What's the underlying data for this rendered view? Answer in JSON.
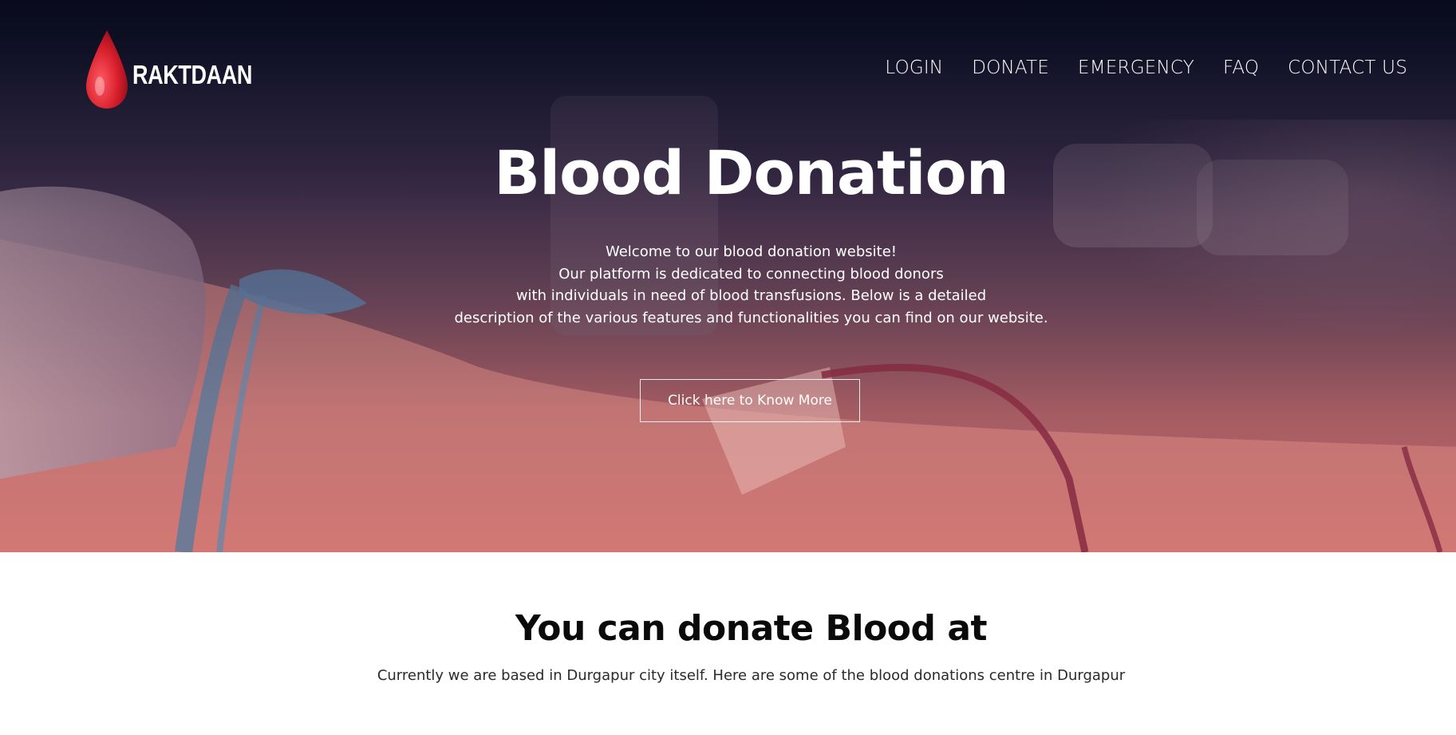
{
  "brand": {
    "name": "RAKTDAAN",
    "logo_icon": "blood-drop-icon",
    "color": "#d61f2c"
  },
  "nav": {
    "items": [
      "LOGIN",
      "DONATE",
      "EMERGENCY",
      "FAQ",
      "CONTACT US"
    ]
  },
  "hero": {
    "title": "Blood Donation",
    "description": [
      "Welcome to our blood donation website!",
      "Our platform is dedicated to connecting blood donors",
      "with individuals in need of blood transfusions. Below is a detailed",
      "description of the various features and functionalities you can find on our website."
    ],
    "button_label": "Click here to Know More"
  },
  "donate_section": {
    "title": "You can donate Blood at",
    "subtitle": "Currently we are based in Durgapur city itself. Here are some of the blood donations centre in Durgapur"
  }
}
